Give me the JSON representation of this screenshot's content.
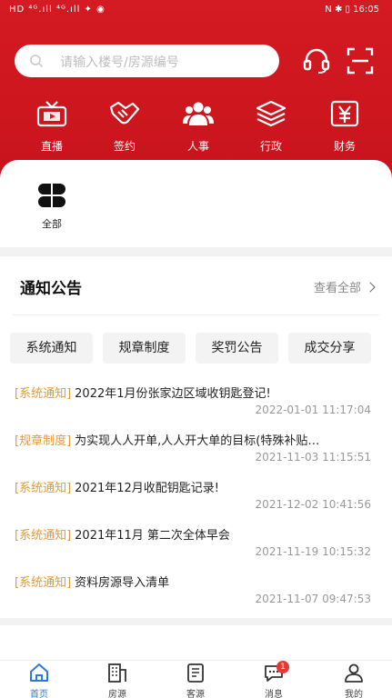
{
  "status_bar": {
    "left": "HD ⁴ᴳ.ıll ⁴ᴳ.ıll ✦ ◉",
    "right": "N ✱ ▯ 16:05"
  },
  "search": {
    "placeholder": "请输入楼号/房源编号"
  },
  "quick_menu": [
    {
      "label": "直播",
      "icon": "tv-icon"
    },
    {
      "label": "签约",
      "icon": "handshake-icon"
    },
    {
      "label": "人事",
      "icon": "people-icon"
    },
    {
      "label": "行政",
      "icon": "layers-icon"
    },
    {
      "label": "财务",
      "icon": "yen-icon"
    }
  ],
  "all_item": {
    "label": "全部"
  },
  "notice": {
    "title": "通知公告",
    "view_all": "查看全部",
    "categories": [
      "系统通知",
      "规章制度",
      "奖罚公告",
      "成交分享"
    ],
    "items": [
      {
        "tag": "[系统通知]",
        "title": "2022年1月份张家边区域收钥匙登记!",
        "date": "2022-01-01 11:17:04"
      },
      {
        "tag": "[规章制度]",
        "title": "为实现人人开单,人人开大单的目标(特殊补贴…",
        "date": "2021-11-03 11:15:51"
      },
      {
        "tag": "[系统通知]",
        "title": "2021年12月收配钥匙记录!",
        "date": "2021-12-02 10:41:56"
      },
      {
        "tag": "[系统通知]",
        "title": "2021年11月 第二次全体早会",
        "date": "2021-11-19 10:15:32"
      },
      {
        "tag": "[系统通知]",
        "title": "资料房源导入清单",
        "date": "2021-11-07 09:47:53"
      }
    ]
  },
  "tabbar": {
    "tabs": [
      {
        "label": "首页"
      },
      {
        "label": "房源"
      },
      {
        "label": "客源"
      },
      {
        "label": "消息",
        "badge": "1"
      },
      {
        "label": "我的"
      }
    ]
  },
  "colors": {
    "brand_red": "#d41a22",
    "tag_orange": "#e39a3a",
    "active_blue": "#2a7ae2"
  }
}
